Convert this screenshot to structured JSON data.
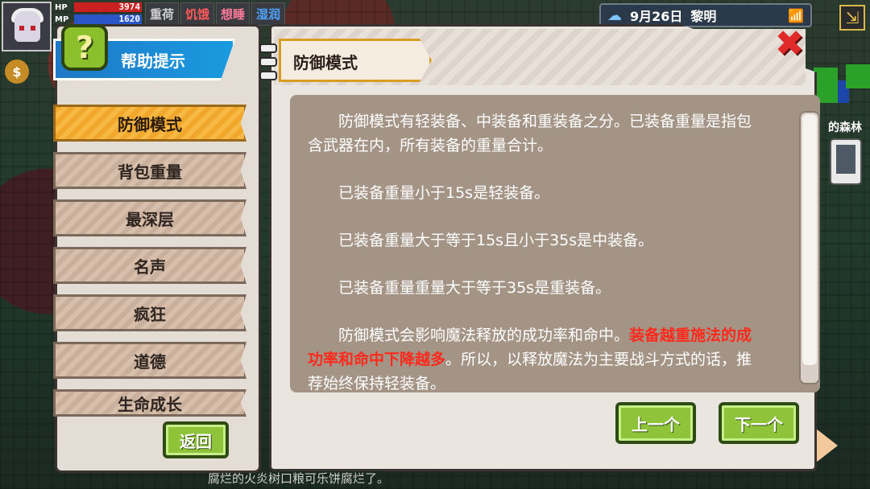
{
  "hud": {
    "hp_label": "HP",
    "hp_value": "3974",
    "mp_label": "MP",
    "mp_value": "1620",
    "status_tags": [
      {
        "label": "重荷",
        "color": "#cfcfcf"
      },
      {
        "label": "饥饿",
        "color": "#ff5a5a"
      },
      {
        "label": "想睡",
        "color": "#ff7a9a"
      },
      {
        "label": "湿润",
        "color": "#4fa3ff"
      }
    ],
    "weather_icon": "cloud-rain-icon",
    "date": "9月26日",
    "time_of_day": "黎明",
    "wifi_icon": "wifi-icon",
    "map_label": "的森林",
    "bottom_log": "腐烂的火炎树口粮可乐饼腐烂了。"
  },
  "help": {
    "title": "帮助提示",
    "qmark": "?",
    "tabs": [
      {
        "label": "防御模式",
        "active": true
      },
      {
        "label": "背包重量",
        "active": false
      },
      {
        "label": "最深层",
        "active": false
      },
      {
        "label": "名声",
        "active": false
      },
      {
        "label": "疯狂",
        "active": false
      },
      {
        "label": "道德",
        "active": false
      },
      {
        "label": "生命成长",
        "active": false
      }
    ],
    "back_label": "返回",
    "header": "防御模式",
    "close_icon": "close-icon",
    "content": {
      "p1": "防御模式有轻装备、中装备和重装备之分。已装备重量是指包含武器在内，所有装备的重量合计。",
      "p2": "已装备重量小于15s是轻装备。",
      "p3": "已装备重量大于等于15s且小于35s是中装备。",
      "p4": "已装备重量重量大于等于35s是重装备。",
      "p5_normal": "防御模式会影响魔法释放的成功率和命中。",
      "p5_red": "装备越重施法的成功率和命中下降越多",
      "p5_tail": "。所以，以释放魔法为主要战斗方式的话，推荐始终保持轻装备。"
    },
    "prev_label": "上一个",
    "next_label": "下一个"
  }
}
